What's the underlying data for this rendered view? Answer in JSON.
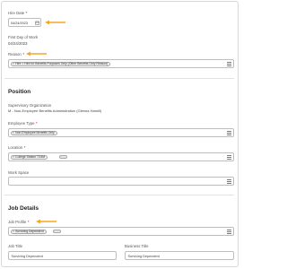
{
  "hire_date": {
    "label": "Hire Date",
    "required": "*",
    "value": "04/24/2023"
  },
  "first_day_of_work": {
    "label": "First Day of Work",
    "value": "04/24/2023"
  },
  "reason": {
    "label": "Reason",
    "required": "*",
    "value": "Hire > Hire for Benefits Purposes Only (Other Benefits Only Reason)"
  },
  "position_section": {
    "heading": "Position",
    "supervisory_org": {
      "label": "Supervisory Organization",
      "value": "M - Non-Employee Benefits Administration (Glenna Hamill)"
    },
    "employee_type": {
      "label": "Employee Type",
      "required": "*",
      "value": "Non-Employee Benefits Only"
    },
    "location": {
      "label": "Location",
      "required": "*",
      "value": "College Station TX4M"
    },
    "work_space": {
      "label": "Work Space"
    }
  },
  "job_details_section": {
    "heading": "Job Details",
    "job_profile": {
      "label": "Job Profile",
      "required": "*",
      "value": "Surviving Dependent"
    },
    "job_title": {
      "label": "Job Title",
      "value": "Surviving Dependent"
    },
    "business_title": {
      "label": "Business Title",
      "value": "Surviving Dependent"
    }
  },
  "colors": {
    "accent_arrow": "#f5a623",
    "required": "#d0021b",
    "border": "#bdbdbd"
  },
  "icons": [
    "calendar-icon",
    "list-icon",
    "remove-x-icon",
    "arrow-annotation"
  ]
}
